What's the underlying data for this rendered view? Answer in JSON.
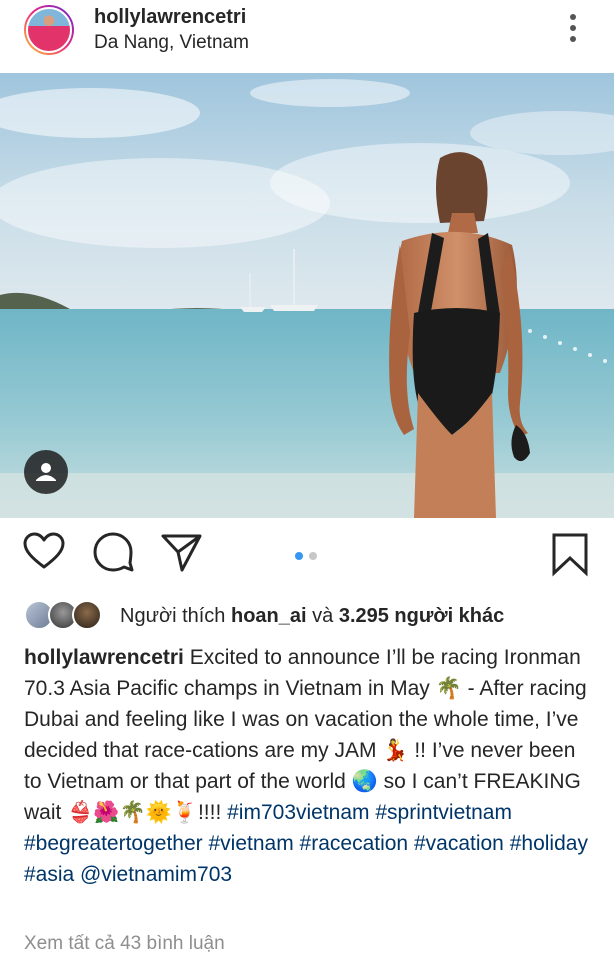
{
  "post": {
    "username": "hollylawrencetri",
    "location": "Da Nang, Vietnam"
  },
  "icons": {
    "more": "more-vertical-icon",
    "user_tag": "person-icon",
    "like": "heart-icon",
    "comment": "comment-icon",
    "share": "paper-plane-icon",
    "save": "bookmark-icon"
  },
  "carousel": {
    "current": 1,
    "total": 2,
    "active_color": "#3897f0",
    "inactive_color": "#c7c7c7"
  },
  "likes": {
    "prefix": "Người thích ",
    "first_user": "hoan_ai",
    "middle": " và ",
    "others": "3.295 người khác"
  },
  "caption": {
    "username": "hollylawrencetri",
    "text_1": " Excited to announce I’ll be racing Ironman 70.3 Asia Pacific champs in Vietnam in May ",
    "emoji_1": "🌴",
    "text_2": " - After racing Dubai and feeling like I was on vacation the whole time, I’ve decided that race-cations are my JAM ",
    "emoji_2": "💃",
    "text_3": " !! I’ve never been to Vietnam or that part of the world ",
    "emoji_3": "🌏",
    "text_4": " so I can’t FREAKING wait ",
    "emoji_4": "👙🌺🌴🌞🍹",
    "text_5": "!!!! ",
    "hashtags": [
      "#im703vietnam",
      "#sprintvietnam",
      "#begreatertogether",
      "#vietnam",
      "#racecation",
      "#vacation",
      "#holiday",
      "#asia"
    ],
    "mention": "@vietnamim703"
  },
  "comments_link": "Xem tất cả 43 bình luận",
  "colors": {
    "link": "#003569",
    "muted": "#8e8e8e",
    "text": "#262626"
  }
}
